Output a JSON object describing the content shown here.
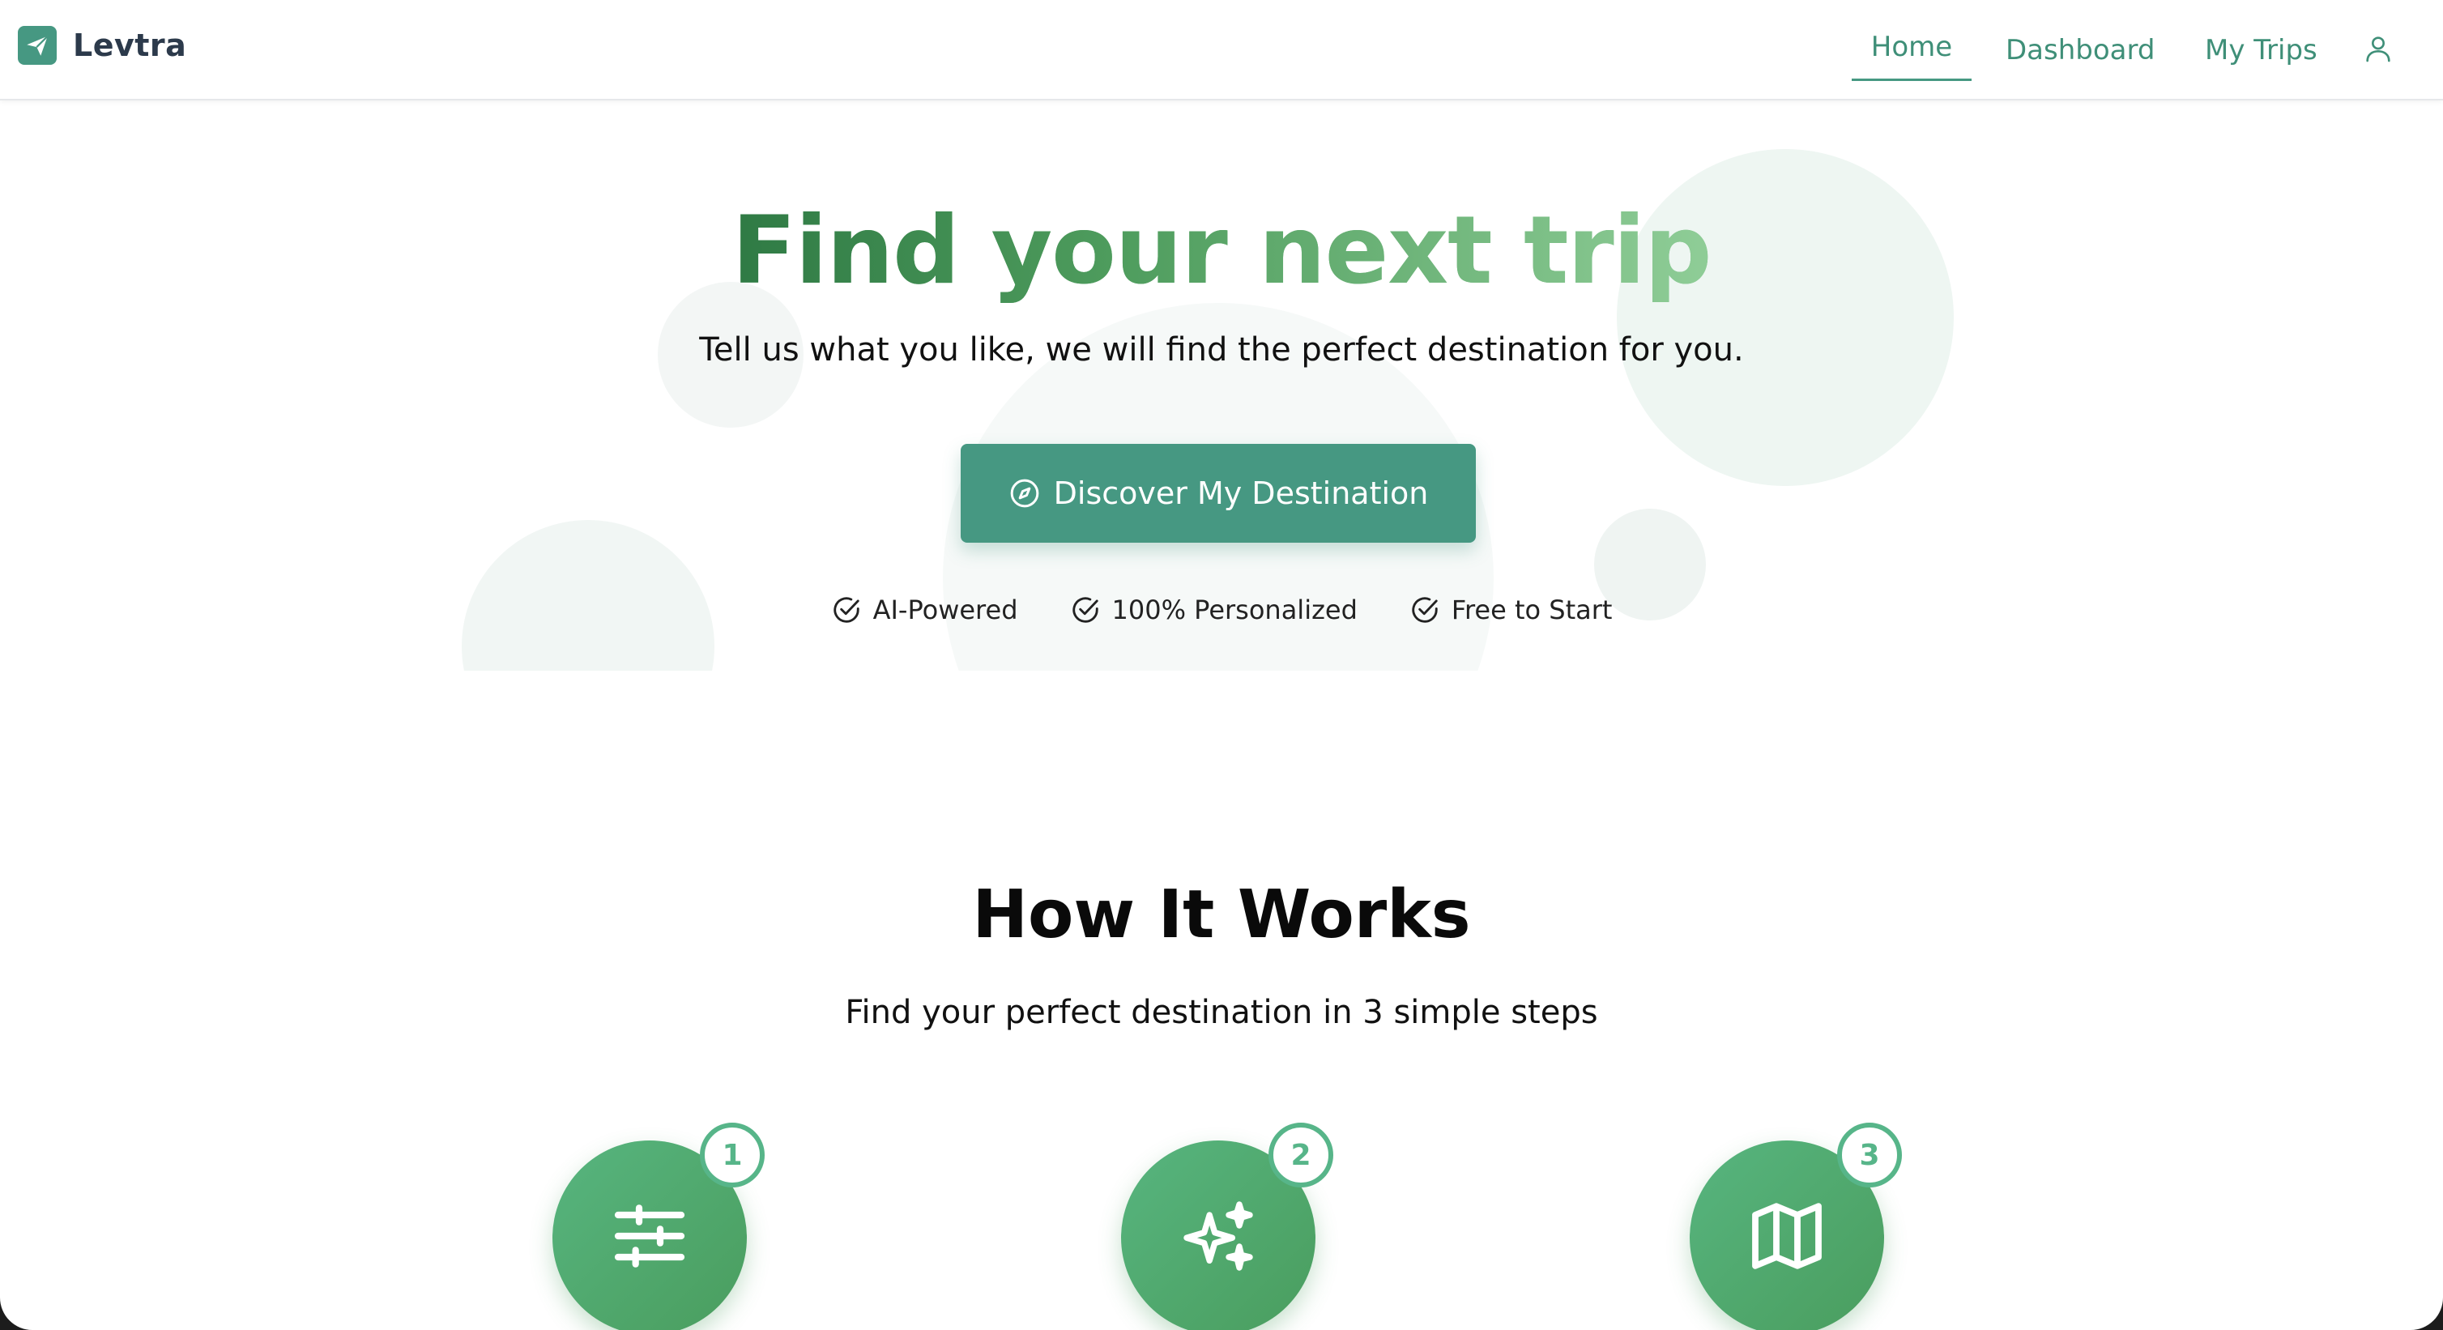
{
  "brand": {
    "name": "Levtra",
    "logo_icon": "paper-plane-icon",
    "accent": "#469882"
  },
  "nav": {
    "home": "Home",
    "dashboard": "Dashboard",
    "my_trips": "My Trips",
    "user_icon": "user-icon",
    "active": "Home"
  },
  "hero": {
    "title": "Find your next trip",
    "subtitle": "Tell us what you like, we will find the perfect destination for you.",
    "cta_label": "Discover My Destination",
    "cta_icon": "compass-icon",
    "features": [
      {
        "label": "AI-Powered",
        "icon": "check-circle-icon"
      },
      {
        "label": "100% Personalized",
        "icon": "check-circle-icon"
      },
      {
        "label": "Free to Start",
        "icon": "check-circle-icon"
      }
    ]
  },
  "how_it_works": {
    "title": "How It Works",
    "subtitle": "Find your perfect destination in 3 simple steps",
    "steps": [
      {
        "number": "1",
        "icon": "sliders-icon"
      },
      {
        "number": "2",
        "icon": "sparkles-icon"
      },
      {
        "number": "3",
        "icon": "map-icon"
      }
    ]
  }
}
